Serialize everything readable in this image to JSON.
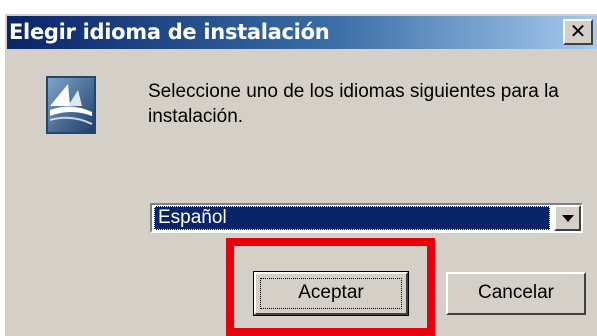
{
  "window": {
    "title": "Elegir idioma de instalación",
    "close_glyph": "×"
  },
  "message": {
    "text": "Seleccione uno de los idiomas siguientes para la instalación."
  },
  "language_select": {
    "selected": "Español"
  },
  "buttons": {
    "ok_label": "Aceptar",
    "cancel_label": "Cancelar"
  },
  "icons": {
    "app_icon": "installer-logo-icon",
    "dropdown": "chevron-down-icon",
    "close": "close-icon"
  },
  "colors": {
    "title_gradient_start": "#0a246a",
    "title_gradient_end": "#a6caf0",
    "highlight": "#e8000d",
    "face": "#d4d0c8"
  }
}
